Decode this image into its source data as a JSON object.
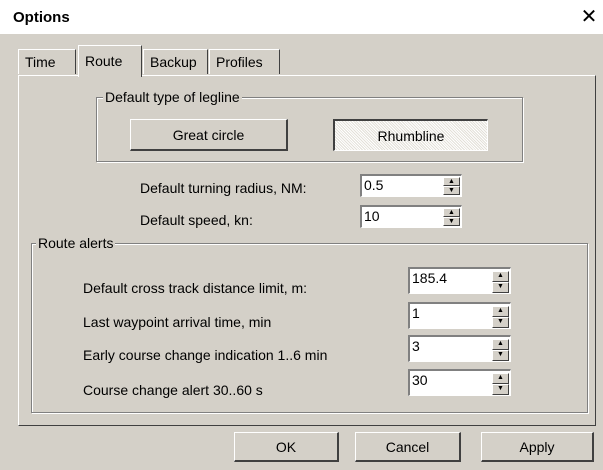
{
  "window": {
    "title": "Options",
    "close_glyph": "✕"
  },
  "tabs": [
    {
      "label": "Time",
      "active": false
    },
    {
      "label": "Route",
      "active": true
    },
    {
      "label": "Backup",
      "active": false
    },
    {
      "label": "Profiles",
      "active": false
    }
  ],
  "legline": {
    "group_title": "Default type of legline",
    "great_circle_label": "Great circle",
    "rhumbline_label": "Rhumbline",
    "selected": "Rhumbline"
  },
  "defaults": {
    "turning_radius_label": "Default turning radius, NM:",
    "turning_radius_value": "0.5",
    "speed_label": "Default speed, kn:",
    "speed_value": "10"
  },
  "route_alerts": {
    "group_title": "Route alerts",
    "cross_track_label": "Default cross track distance limit, m:",
    "cross_track_value": "185.4",
    "arrival_label": "Last waypoint arrival time, min",
    "arrival_value": "1",
    "early_change_label": "Early course change indication 1..6 min",
    "early_change_value": "3",
    "change_alert_label": "Course change alert 30..60 s",
    "change_alert_value": "30"
  },
  "footer": {
    "ok_label": "OK",
    "cancel_label": "Cancel",
    "apply_label": "Apply"
  },
  "icons": {
    "spin_up": "▲",
    "spin_down": "▼"
  },
  "colors": {
    "face": "#d4d0c8",
    "highlight": "#ffffff",
    "shadow": "#404040"
  }
}
